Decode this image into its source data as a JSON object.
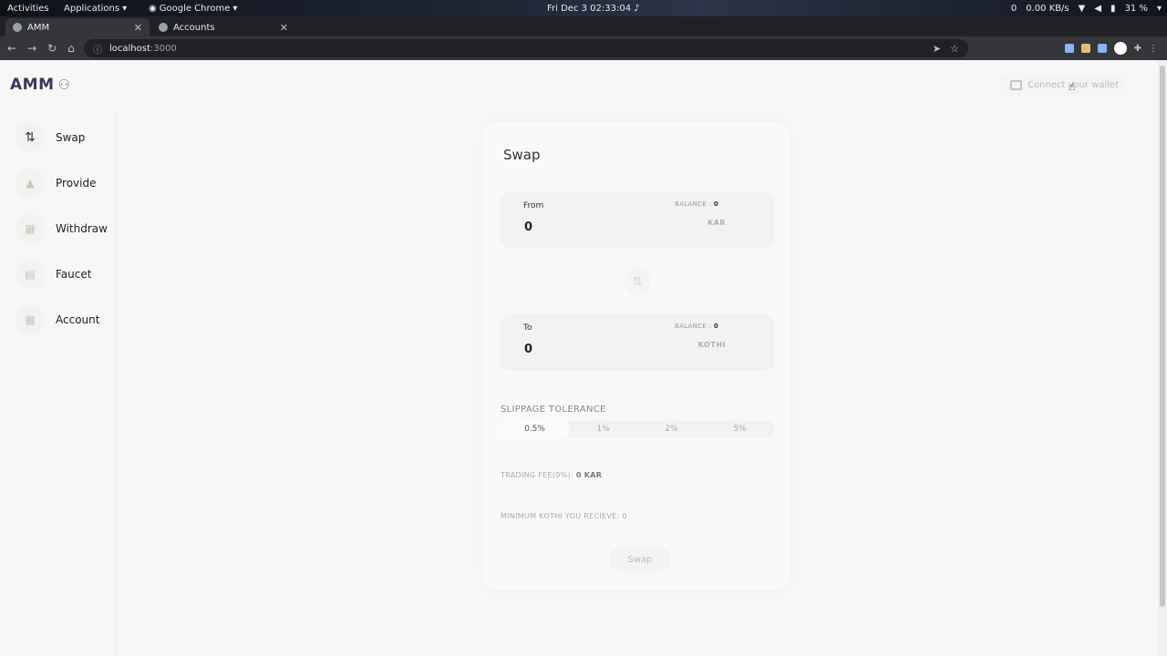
{
  "system_bar": {
    "activities": "Activities",
    "applications": "Applications",
    "chrome_app": "Google Chrome",
    "datetime": "Fri Dec 3  02:33:04",
    "notifications": "0",
    "net_speed": "0.00 KB/s",
    "battery": "31 %"
  },
  "browser": {
    "tabs": [
      {
        "title": "AMM",
        "active": true
      },
      {
        "title": "Accounts",
        "active": false
      }
    ],
    "url_host": "localhost",
    "url_port": ":3000"
  },
  "app": {
    "logo_text": "AMM",
    "connect_wallet_label": "Connect your wallet",
    "sidebar": {
      "items": [
        {
          "label": "Swap",
          "icon": "swap-arrows-icon"
        },
        {
          "label": "Provide",
          "icon": "provide-icon"
        },
        {
          "label": "Withdraw",
          "icon": "withdraw-icon"
        },
        {
          "label": "Faucet",
          "icon": "faucet-icon"
        },
        {
          "label": "Account",
          "icon": "account-icon"
        }
      ]
    },
    "swap_card": {
      "title": "Swap",
      "from": {
        "label": "From",
        "balance_label": "BALANCE :",
        "balance_value": "0",
        "amount": "0",
        "token": "KAR"
      },
      "to": {
        "label": "To",
        "balance_label": "BALANCE :",
        "balance_value": "0",
        "amount": "0",
        "token": "KOTHI"
      },
      "slippage_title": "SLIPPAGE TOLERANCE",
      "slippage_options": [
        "0.5%",
        "1%",
        "2%",
        "5%"
      ],
      "slippage_selected": "0.5%",
      "trading_fee_label": "TRADING FEE(0%):",
      "trading_fee_value": "0 KAR",
      "min_receive_text": "MINIMUM KOTHI YOU RECIEVE: 0",
      "submit_label": "Swap"
    }
  }
}
